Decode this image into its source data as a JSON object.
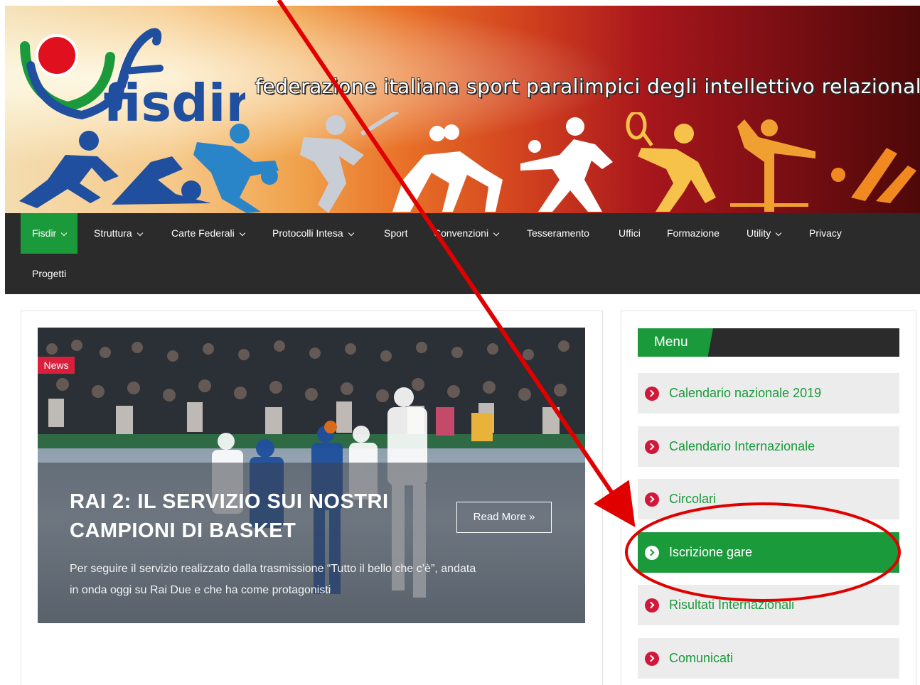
{
  "banner": {
    "logo_text": "fisdir",
    "tagline": "federazione italiana sport paralimpici degli intellettivo relazionali"
  },
  "nav": {
    "items": [
      {
        "label": "Fisdir",
        "dropdown": true,
        "active": true
      },
      {
        "label": "Struttura",
        "dropdown": true
      },
      {
        "label": "Carte Federali",
        "dropdown": true
      },
      {
        "label": "Protocolli Intesa",
        "dropdown": true
      },
      {
        "label": "Sport",
        "dropdown": false
      },
      {
        "label": "Convenzioni",
        "dropdown": true
      },
      {
        "label": "Tesseramento",
        "dropdown": false
      },
      {
        "label": "Uffici",
        "dropdown": false
      },
      {
        "label": "Formazione",
        "dropdown": false
      },
      {
        "label": "Utility",
        "dropdown": true
      },
      {
        "label": "Privacy",
        "dropdown": false
      },
      {
        "label": "Progetti",
        "dropdown": false
      }
    ]
  },
  "feature": {
    "badge": "News",
    "title": "RAI 2: IL SERVIZIO SUI NOSTRI CAMPIONI DI BASKET",
    "excerpt": "Per seguire il servizio realizzato dalla trasmissione “Tutto il bello che c’è”, andata in onda oggi su Rai Due e che ha come protagonisti",
    "read_more": "Read More »"
  },
  "sidebar": {
    "heading": "Menu",
    "items": [
      {
        "label": "Calendario nazionale 2019"
      },
      {
        "label": "Calendario Internazionale"
      },
      {
        "label": "Circolari"
      },
      {
        "label": "Iscrizione gare",
        "active": true
      },
      {
        "label": "Risultati Internazionali"
      },
      {
        "label": "Comunicati"
      }
    ]
  },
  "colors": {
    "accent_green": "#1b9a3c",
    "nav_dark": "#2b2b2b",
    "badge_red": "#d91f3c",
    "annotation_red": "#e00000"
  }
}
